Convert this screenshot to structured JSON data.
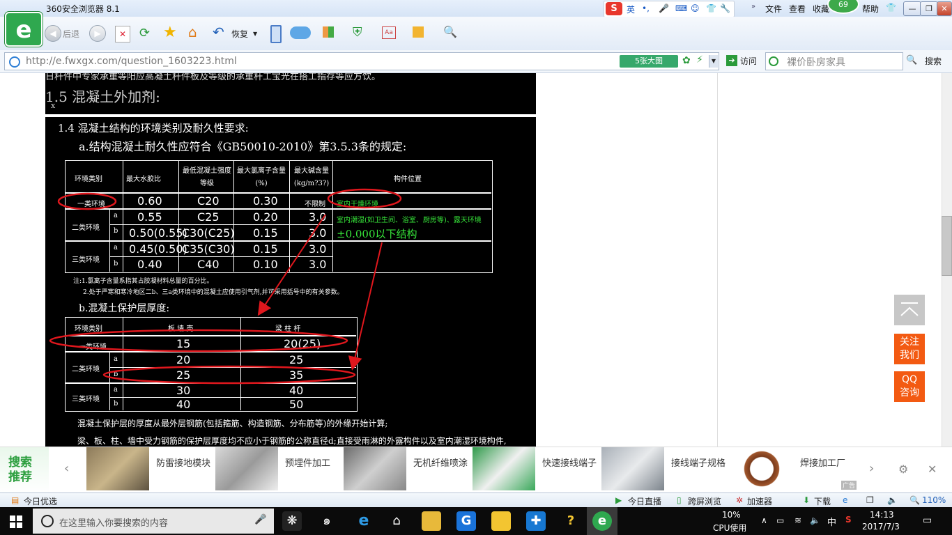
{
  "window": {
    "title": "360安全浏览器 8.1",
    "badge": "69"
  },
  "menu": {
    "file": "文件",
    "view": "查看",
    "favorites": "收藏",
    "help": "帮助"
  },
  "ime": {
    "mode": "英",
    "logo": "S"
  },
  "toolbar": {
    "back": "后退",
    "restore": "恢复"
  },
  "address": {
    "url": "http://e.fwxgx.com/question_1603223.html",
    "big_pic": "5张大图",
    "visit": "访问",
    "search_placeholder": "裸价卧房家具",
    "search_button": "搜索"
  },
  "cad": {
    "top_note": "日杆件中专家承重等阳应高凝土杆件板及等级的承重杆工宝光在搭工指存等应方饮。",
    "sec15": "1.5  混凝土外加剂:",
    "sec15_mark": "x",
    "sec14": "1.4  混凝土结构的环境类别及耐久性要求:",
    "item_a": "a.结构混凝土耐久性应符合《GB50010-2010》第3.5.3条的规定:",
    "t1_headers": [
      "环境类别",
      "最大水胶比",
      "最低混凝土强度等级",
      "最大氯离子含量(%)",
      "最大碱含量(kg/m?3?)",
      "构件位置"
    ],
    "t1_rows": [
      {
        "env": "一类环境",
        "sub": "",
        "wb": "0.60",
        "grade": "C20",
        "cl": "0.30",
        "alk": "不限制",
        "pos": "室内干燥环境"
      },
      {
        "env": "二类环境",
        "sub": "a",
        "wb": "0.55",
        "grade": "C25",
        "cl": "0.20",
        "alk": "3.0",
        "pos": "室内潮湿(如卫生间、浴室、厨房等)、露天环境"
      },
      {
        "env": "",
        "sub": "b",
        "wb": "0.50(0.55)",
        "grade": "C30(C25)",
        "cl": "0.15",
        "alk": "3.0",
        "pos": "±0.000以下结构"
      },
      {
        "env": "三类环境",
        "sub": "a",
        "wb": "0.45(0.50)",
        "grade": "C35(C30)",
        "cl": "0.15",
        "alk": "3.0",
        "pos": ""
      },
      {
        "env": "",
        "sub": "b",
        "wb": "0.40",
        "grade": "C40",
        "cl": "0.10",
        "alk": "3.0",
        "pos": ""
      }
    ],
    "note1": "注:1.氯离子含量系指其占胶凝材料总量的百分比。",
    "note2": "2.处于严寒和寒冷地区二b、三a类环境中的混凝土应使用引气剂,并可采用括号中的有关参数。",
    "item_b": "b.混凝土保护层厚度:",
    "t2_headers": [
      "环境类别",
      "板 墙 壳",
      "梁 柱 杆"
    ],
    "t2_rows": [
      {
        "env": "一类环境",
        "sub": "",
        "slab": "15",
        "beam": "20(25)"
      },
      {
        "env": "二类环境",
        "sub": "a",
        "slab": "20",
        "beam": "25"
      },
      {
        "env": "",
        "sub": "b",
        "slab": "25",
        "beam": "35"
      },
      {
        "env": "三类环境",
        "sub": "a",
        "slab": "30",
        "beam": "40"
      },
      {
        "env": "",
        "sub": "b",
        "slab": "40",
        "beam": "50"
      }
    ],
    "bottom1": "混凝土保护层的厚度从最外层钢筋(包括箍筋、构造钢筋、分布筋等)的外缘开始计算;",
    "bottom2": "梁、板、柱、墙中受力钢筋的保护层厚度均不应小于钢筋的公称直径d;直接受雨淋的外露构件以及室内潮湿环境构件,"
  },
  "side": {
    "follow": "关注我们",
    "qq": "QQ咨询"
  },
  "ads": {
    "label": "搜索推荐",
    "items": [
      "防雷接地模块",
      "预埋件加工",
      "无机纤维喷涂",
      "快速接线端子",
      "接线端子规格",
      "焊接加工厂"
    ],
    "tag": "广告"
  },
  "status": {
    "left": "今日优选",
    "live": "今日直播",
    "cross": "跨屏浏览",
    "accel": "加速器",
    "download": "下载",
    "zoom": "110%"
  },
  "taskbar": {
    "search": "在这里输入你要搜索的内容",
    "cpu_pct": "10%",
    "cpu_label": "CPU使用",
    "ime": "中",
    "time": "14:13",
    "date": "2017/7/3"
  }
}
